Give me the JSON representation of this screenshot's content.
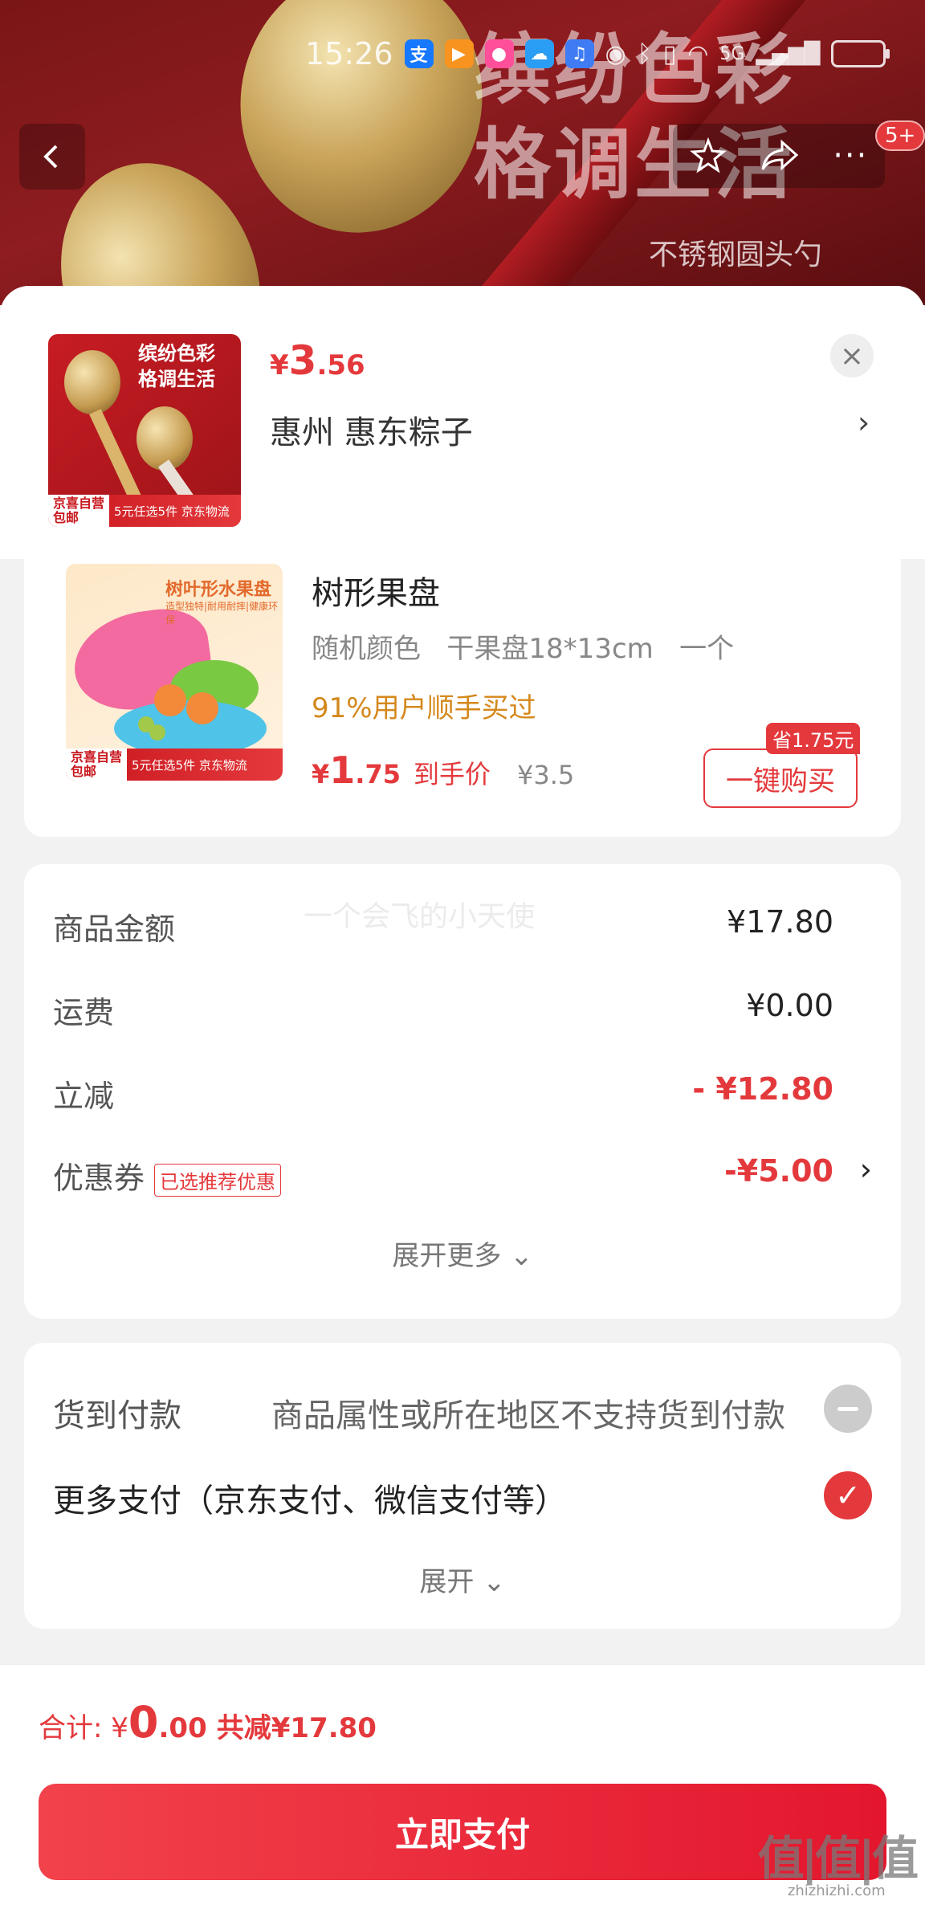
{
  "status_bar": {
    "time": "15:26",
    "icons": [
      "alipay-icon",
      "bilibili-icon",
      "tmall-icon",
      "weather-icon",
      "music-icon",
      "eye-icon",
      "bluetooth-icon",
      "vibrate-icon",
      "wifi-icon",
      "5g-signal-icon",
      "signal-icon",
      "battery-icon"
    ]
  },
  "hero": {
    "title_line1": "缤纷色彩",
    "title_line2": "格调生活",
    "subtitle": "不锈钢圆头勺"
  },
  "header": {
    "more_badge": "5+"
  },
  "product": {
    "price_currency": "¥",
    "price_int": "3",
    "price_dec": ".56",
    "address": "惠州  惠东粽子",
    "thumb_text_line1": "缤纷色彩",
    "thumb_text_line2": "格调生活",
    "thumb_tag_a": "京喜自营",
    "thumb_tag_b": "包邮",
    "thumb_tag_text": "5元任选5件 京东物流"
  },
  "recommend": {
    "name": "树形果盘",
    "spec": "随机颜色   干果盘18*13cm   一个",
    "social_proof": "91%用户顺手买过",
    "price_currency": "¥",
    "price_int": "1",
    "price_dec": ".75",
    "price_label": "到手价",
    "original_price": "¥3.5",
    "save_badge": "省1.75元",
    "buy_label": "一键购买",
    "thumb_title": "树叶形水果盘",
    "thumb_sub": "造型独特|耐用耐摔|健康环保",
    "thumb_tag_a": "京喜自营",
    "thumb_tag_b": "包邮",
    "thumb_tag_text": "5元任选5件 京东物流"
  },
  "summary": {
    "watermark": "一个会飞的小天使",
    "rows": [
      {
        "label": "商品金额",
        "value": "¥17.80"
      },
      {
        "label": "运费",
        "value": "¥0.00"
      },
      {
        "label": "立减",
        "value": "- ¥12.80"
      },
      {
        "label": "优惠券",
        "tag": "已选推荐优惠",
        "value": "-¥5.00"
      }
    ],
    "expand_label": "展开更多"
  },
  "payment": {
    "cod_label": "货到付款",
    "cod_note": "商品属性或所在地区不支持货到付款",
    "more_label": "更多支付（京东支付、微信支付等）",
    "expand_label": "展开"
  },
  "footer": {
    "total_label": "合计:",
    "total_currency": "¥",
    "total_int": "0",
    "total_dec": ".00",
    "total_saved": "共减¥17.80",
    "pay_button": "立即支付"
  },
  "site_mark": {
    "big": "值|值|值",
    "small": "zhizhizhi.com"
  },
  "colors": {
    "accent": "#e4393c",
    "social_proof": "#d4881b",
    "background": "#f2f2f2"
  }
}
